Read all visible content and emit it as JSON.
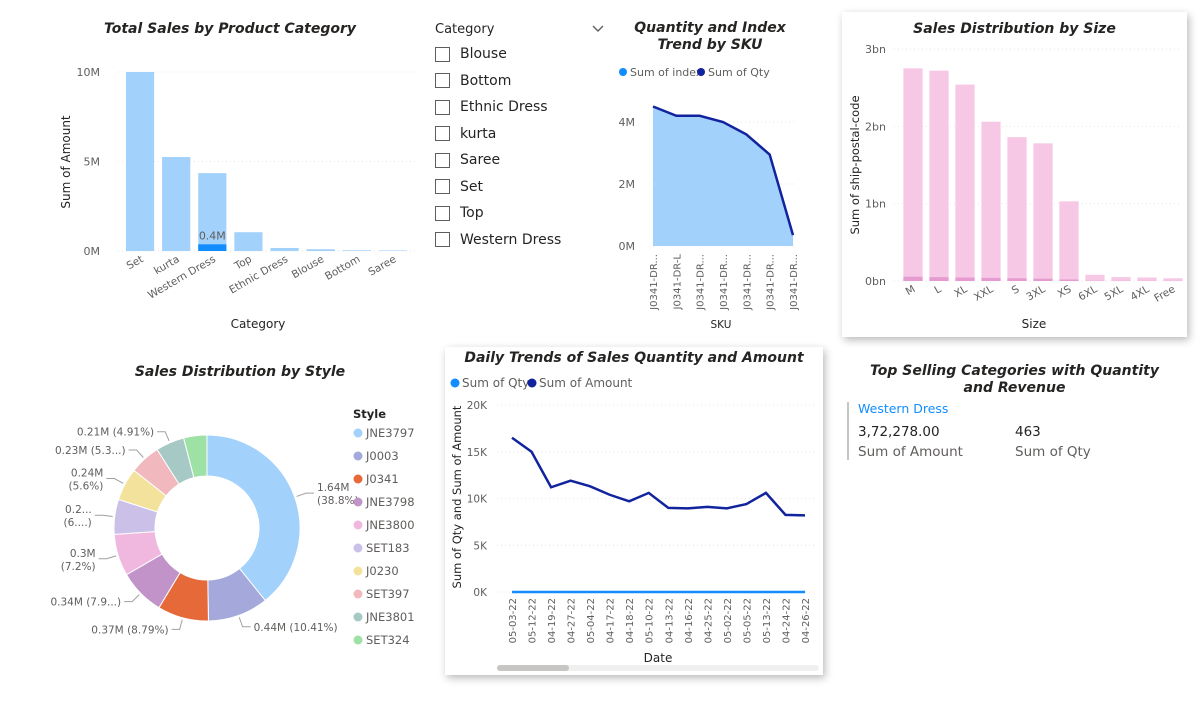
{
  "colors": {
    "light_blue": "#a2d1fb",
    "highlight_blue": "#118dff",
    "navy": "#12239e",
    "pink": "#f6c8e6",
    "pink_dark": "#e59bcf",
    "grid": "#e6e6e6",
    "text": "#252423",
    "muted": "#605e5c"
  },
  "chart_data": [
    {
      "id": "category_sales",
      "type": "bar",
      "title": "Total Sales by Product Category",
      "xlabel": "Category",
      "ylabel": "Sum of Amount",
      "yticks": [
        "0M",
        "5M",
        "10M"
      ],
      "ylim": [
        0,
        10400000
      ],
      "categories": [
        "Set",
        "kurta",
        "Western Dress",
        "Top",
        "Ethnic Dress",
        "Blouse",
        "Bottom",
        "Saree"
      ],
      "series": [
        {
          "values": [
            10000000,
            5250000,
            4350000,
            1050000,
            170000,
            100000,
            40000,
            30000
          ]
        }
      ],
      "highlight": {
        "category": "Western Dress",
        "value": 372278,
        "label": "0.4M"
      }
    },
    {
      "id": "sku_trend",
      "type": "area",
      "title": "Quantity and Index Trend by SKU",
      "xlabel": "SKU",
      "ylabel": "",
      "yticks": [
        "0M",
        "2M",
        "4M"
      ],
      "ylim": [
        0,
        5000000
      ],
      "categories": [
        "J0341-DR...",
        "J0341-DR-L",
        "J0341-DR...",
        "J0341-DR...",
        "J0341-DR...",
        "J0341-DR...",
        "J0341-DR..."
      ],
      "series": [
        {
          "name": "Sum of index",
          "values": [
            4500000,
            4200000,
            4200000,
            4000000,
            3600000,
            2950000,
            350000
          ]
        },
        {
          "name": "Sum of Qty",
          "values": [
            0,
            0,
            0,
            0,
            0,
            0,
            0
          ]
        }
      ],
      "legend": "top-left"
    },
    {
      "id": "size_distribution",
      "type": "bar",
      "title": "Sales Distribution by Size",
      "xlabel": "Size",
      "ylabel": "Sum of ship-postal-code",
      "yticks": [
        "0bn",
        "1bn",
        "2bn",
        "3bn"
      ],
      "ylim": [
        0,
        3000000000
      ],
      "categories": [
        "M",
        "L",
        "XL",
        "XXL",
        "S",
        "3XL",
        "XS",
        "6XL",
        "5XL",
        "4XL",
        "Free"
      ],
      "series": [
        {
          "values": [
            2750000000,
            2720000000,
            2540000000,
            2060000000,
            1860000000,
            1780000000,
            1030000000,
            80000000,
            50000000,
            45000000,
            35000000
          ]
        }
      ],
      "overlay_values": [
        55000000,
        50000000,
        45000000,
        40000000,
        35000000,
        30000000,
        20000000,
        3000000,
        2000000,
        2000000,
        1000000
      ]
    },
    {
      "id": "style_distribution",
      "type": "pie",
      "title": "Sales Distribution by Style",
      "legend_title": "Style",
      "legend": "right",
      "slices": [
        {
          "name": "JNE3797",
          "value": 38.8,
          "color": "#a2d1fb",
          "label": "1.64M (38.8%)"
        },
        {
          "name": "J0003",
          "value": 10.41,
          "color": "#a4a8db",
          "label": "0.44M (10.41%)"
        },
        {
          "name": "J0341",
          "value": 8.79,
          "color": "#e6693a",
          "label": "0.37M (8.79%)"
        },
        {
          "name": "JNE3798",
          "value": 7.9,
          "color": "#c193c9",
          "label": "0.34M (7.9...)"
        },
        {
          "name": "JNE3800",
          "value": 7.2,
          "color": "#f1b8df",
          "label": "0.3M (7.2%)"
        },
        {
          "name": "SET183",
          "value": 6.0,
          "color": "#cbc0e8",
          "label": "0.2... (6....)"
        },
        {
          "name": "J0230",
          "value": 5.6,
          "color": "#f2e29b",
          "label": "0.24M (5.6%)"
        },
        {
          "name": "SET397",
          "value": 5.3,
          "color": "#f1b8bd",
          "label": "0.23M (5.3...)"
        },
        {
          "name": "JNE3801",
          "value": 4.91,
          "color": "#a6c9c5",
          "label": "0.21M (4.91%)"
        },
        {
          "name": "SET324",
          "value": 4.0,
          "color": "#9ee1a5",
          "label": ""
        }
      ]
    },
    {
      "id": "daily_trends",
      "type": "line",
      "title": "Daily Trends of Sales Quantity and Amount",
      "xlabel": "Date",
      "ylabel": "Sum of Qty and Sum of Amount",
      "yticks": [
        "0K",
        "5K",
        "10K",
        "15K",
        "20K"
      ],
      "ylim": [
        0,
        20000
      ],
      "categories": [
        "05-03-22",
        "05-12-22",
        "04-19-22",
        "04-27-22",
        "05-04-22",
        "04-17-22",
        "04-18-22",
        "05-10-22",
        "04-13-22",
        "04-16-22",
        "04-25-22",
        "05-02-22",
        "05-05-22",
        "05-13-22",
        "04-24-22",
        "04-26-22"
      ],
      "series": [
        {
          "name": "Sum of Qty",
          "values": [
            5,
            5,
            5,
            5,
            5,
            5,
            5,
            5,
            5,
            5,
            5,
            5,
            5,
            5,
            5,
            5
          ]
        },
        {
          "name": "Sum of Amount",
          "values": [
            16500,
            15000,
            11200,
            11900,
            11300,
            10400,
            9700,
            10600,
            9000,
            8950,
            9100,
            8950,
            9400,
            10600,
            8250,
            8200
          ]
        }
      ],
      "legend": "top-left"
    }
  ],
  "slicer": {
    "title": "Category",
    "items": [
      "Blouse",
      "Bottom",
      "Ethnic Dress",
      "kurta",
      "Saree",
      "Set",
      "Top",
      "Western Dress"
    ]
  },
  "card": {
    "title": "Top Selling Categories with Quantity and Revenue",
    "category": "Western Dress",
    "amount_value": "3,72,278.00",
    "amount_label": "Sum of Amount",
    "qty_value": "463",
    "qty_label": "Sum of Qty"
  }
}
